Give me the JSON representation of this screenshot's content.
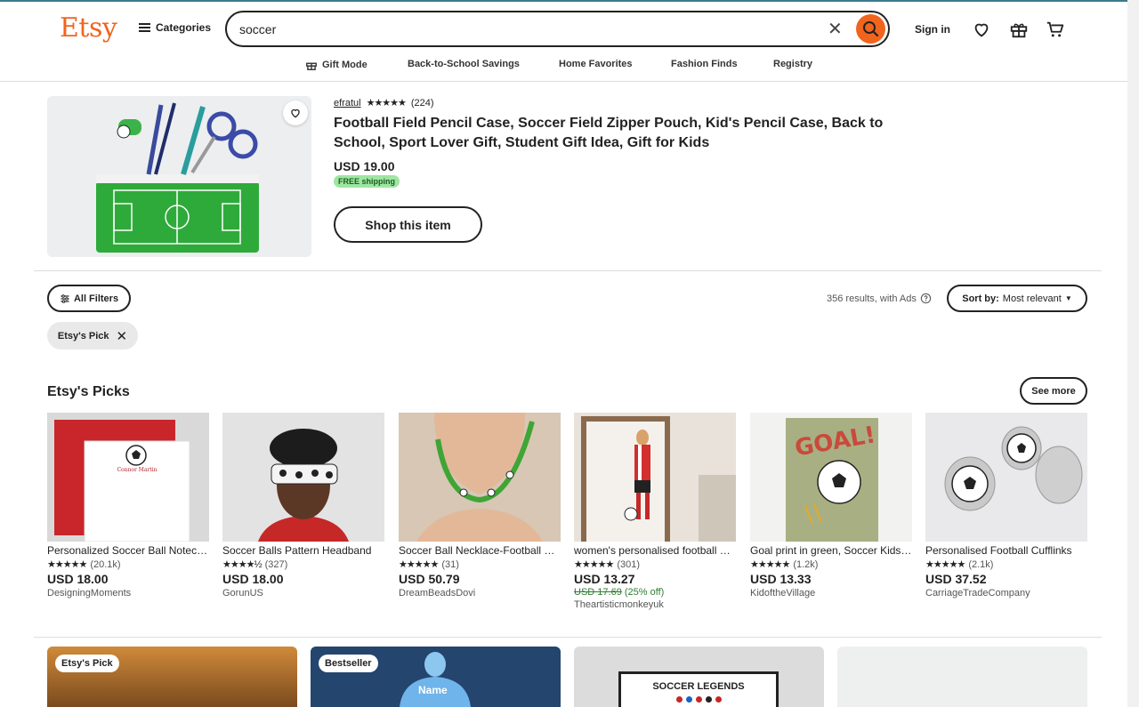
{
  "header": {
    "logo": "Etsy",
    "categories_label": "Categories",
    "search_value": "soccer",
    "sign_in": "Sign in"
  },
  "subnav": {
    "items": [
      "Gift Mode",
      "Back-to-School Savings",
      "Home Favorites",
      "Fashion Finds",
      "Registry"
    ]
  },
  "ad": {
    "shop": "efratul",
    "stars": "★★★★★",
    "reviews": "(224)",
    "title": "Football Field Pencil Case, Soccer Field Zipper Pouch, Kid's Pencil Case, Back to School, Sport Lover Gift, Student Gift Idea, Gift for Kids",
    "price": "USD 19.00",
    "shipping": "FREE shipping",
    "shop_button": "Shop this item"
  },
  "filters": {
    "all_filters": "All Filters",
    "chip": "Etsy's Pick",
    "results": "356 results, with Ads",
    "sort_label": "Sort by:",
    "sort_value": "Most relevant"
  },
  "picks": {
    "title": "Etsy's Picks",
    "see_more": "See more",
    "items": [
      {
        "title": "Personalized Soccer Ball Notecards",
        "stars": "★★★★★",
        "reviews": "(20.1k)",
        "price": "USD 18.00",
        "shop": "DesigningMoments",
        "card_text": "Connor Martin"
      },
      {
        "title": "Soccer Balls Pattern Headband",
        "stars": "★★★★½",
        "reviews": "(327)",
        "price": "USD 18.00",
        "shop": "GorunUS"
      },
      {
        "title": "Soccer Ball Necklace-Football Necklace",
        "stars": "★★★★★",
        "reviews": "(31)",
        "price": "USD 50.79",
        "shop": "DreamBeadsDovi"
      },
      {
        "title": "women's personalised football print",
        "stars": "★★★★★",
        "reviews": "(301)",
        "price": "USD 13.27",
        "original_price": "USD 17.69",
        "discount": "(25% off)",
        "shop": "Theartisticmonkeyuk"
      },
      {
        "title": "Goal print in green, Soccer Kids Room",
        "stars": "★★★★★",
        "reviews": "(1.2k)",
        "price": "USD 13.33",
        "shop": "KidoftheVillage",
        "art_text": "GOAL!"
      },
      {
        "title": "Personalised Football Cufflinks",
        "stars": "★★★★★",
        "reviews": "(2.1k)",
        "price": "USD 37.52",
        "shop": "CarriageTradeCompany"
      }
    ]
  },
  "grid": {
    "badges": [
      "Etsy's Pick",
      "Bestseller"
    ],
    "jersey_text": "Name",
    "poster_text": "SOCCER LEGENDS"
  },
  "colors": {
    "brand": "#f1641e",
    "free_shipping_bg": "#9ee6a2",
    "discount": "#2e7d32"
  }
}
